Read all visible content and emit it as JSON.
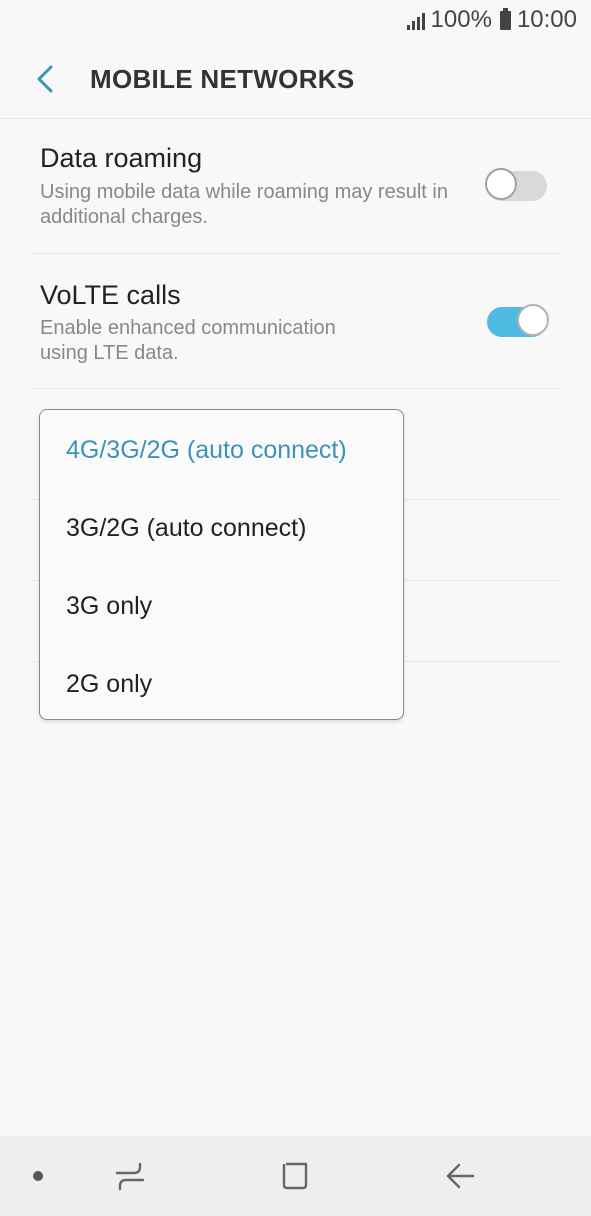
{
  "status_bar": {
    "battery": "100%",
    "time": "10:00"
  },
  "header": {
    "title": "MOBILE NETWORKS",
    "back_icon": "chevron-left-icon"
  },
  "settings": {
    "data_roaming": {
      "title": "Data roaming",
      "description": "Using mobile data while roaming may result in additional charges.",
      "enabled": false
    },
    "volte_calls": {
      "title": "VoLTE calls",
      "description": "Enable enhanced communication using LTE data.",
      "enabled": true
    }
  },
  "network_mode_dropdown": {
    "selected": "4G/3G/2G (auto connect)",
    "options": [
      "4G/3G/2G (auto connect)",
      "3G/2G (auto connect)",
      "3G only",
      "2G only"
    ]
  },
  "colors": {
    "accent": "#3c93b8",
    "toggle_on": "#4fbbe3",
    "toggle_off": "#d9d9d9"
  },
  "nav_bar": {
    "items": [
      "dot-icon",
      "recents-icon",
      "home-icon",
      "back-icon"
    ]
  }
}
